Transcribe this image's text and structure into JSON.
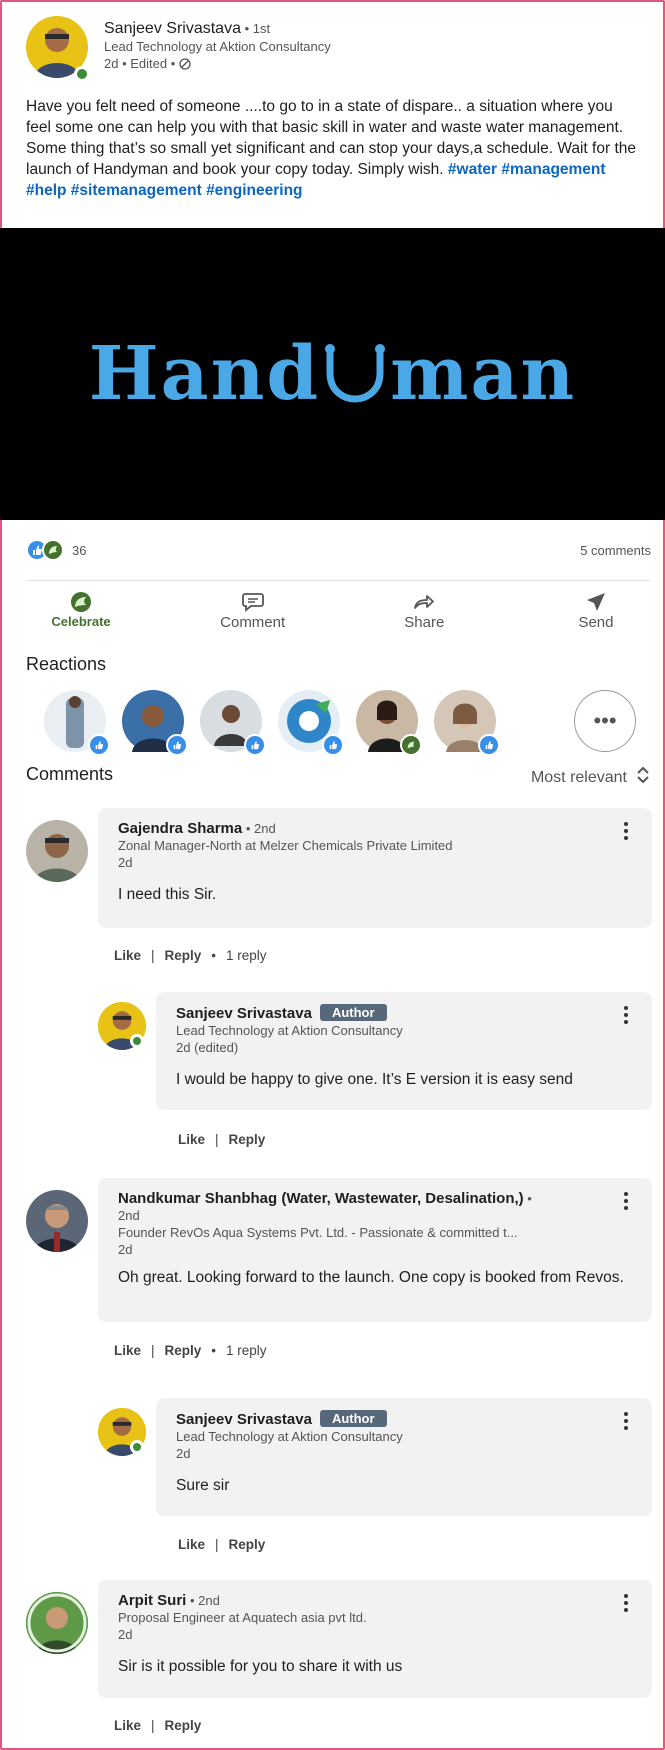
{
  "post": {
    "author": "Sanjeev Srivastava",
    "degree": " • 1st",
    "headline": "Lead Technology at Aktion Consultancy",
    "meta": "2d • Edited • ",
    "text": "Have you felt need of someone ....to go to in a state of dispare.. a situation where you feel some one can help you with that basic skill in water and waste water management. Some thing that’s so small yet significant and can stop your days,a schedule. Wait for the launch of Handyman and book your copy today. Simply wish. ",
    "hashtags": [
      "#water",
      "#management",
      "#help",
      "#sitemanagement",
      "#engineering"
    ],
    "banner": {
      "text_left": "Hand",
      "text_right": "man"
    }
  },
  "social": {
    "reaction_count": "36",
    "comments_count": "5 comments"
  },
  "actions": {
    "celebrate": "Celebrate",
    "comment": "Comment",
    "share": "Share",
    "send": "Send"
  },
  "sections": {
    "reactions": "Reactions",
    "comments": "Comments",
    "sort": "Most relevant"
  },
  "comments": [
    {
      "name": "Gajendra Sharma",
      "degree": " • 2nd",
      "role": "Zonal Manager-North at Melzer Chemicals Private Limited",
      "time": "2d",
      "text": "I need this Sir.",
      "like": "Like",
      "reply": "Reply",
      "replies": "1 reply"
    },
    {
      "name": "Sanjeev Srivastava",
      "badge": "Author",
      "role": "Lead Technology at Aktion Consultancy",
      "time": "2d (edited)",
      "text": "I would be happy to give one. It’s E version it is easy send",
      "like": "Like",
      "reply": "Reply"
    },
    {
      "name": "Nandkumar Shanbhag (Water, Wastewater, Desalination,)",
      "degree": " •",
      "degree2": "2nd",
      "role": "Founder RevOs Aqua Systems Pvt. Ltd. - Passionate & committed t...",
      "time": "2d",
      "text": "Oh great. Looking forward to the launch. One copy is booked from Revos.",
      "like": "Like",
      "reply": "Reply",
      "replies": "1 reply"
    },
    {
      "name": "Sanjeev Srivastava",
      "badge": "Author",
      "role": "Lead Technology at Aktion Consultancy",
      "time": "2d",
      "text": "Sure sir",
      "like": "Like",
      "reply": "Reply"
    },
    {
      "name": "Arpit Suri",
      "degree": " • 2nd",
      "role": "Proposal Engineer at Aquatech asia pvt ltd.",
      "time": "2d",
      "text": "Sir is it possible for you to share it with us",
      "like": "Like",
      "reply": "Reply"
    }
  ],
  "colors": {
    "brand_blue": "#0a66c2",
    "like_blue": "#378fe9",
    "celebrate_green": "#44712e",
    "author_badge": "#56687a",
    "frame_pink": "#e0577f"
  }
}
